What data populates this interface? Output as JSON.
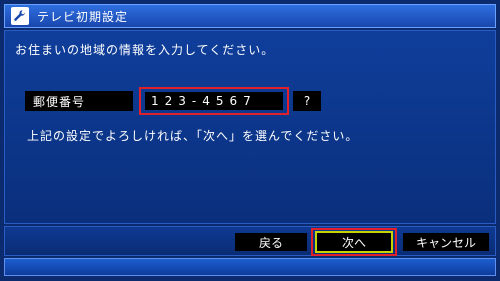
{
  "window": {
    "title": "テレビ初期設定",
    "icon": "wrench-icon"
  },
  "main": {
    "instruction": "お住まいの地域の情報を入力してください。",
    "zip": {
      "label": "郵便番号",
      "value": "123-4567",
      "help_label": "?"
    },
    "note": "上記の設定でよろしければ、「次へ」を選んでください。"
  },
  "buttons": {
    "back": "戻る",
    "next": "次へ",
    "cancel": "キャンセル"
  },
  "colors": {
    "background": "#0c2a6e",
    "titlebar": "#2f6fe0",
    "highlight_border": "#e0202a",
    "focus_outline": "#c8d400"
  }
}
